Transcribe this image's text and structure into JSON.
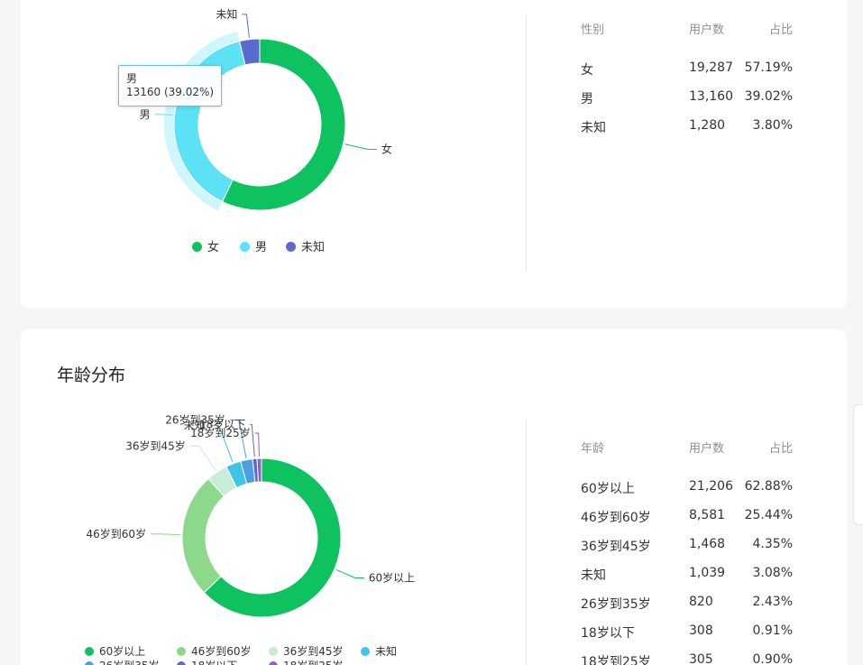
{
  "gender": {
    "table": {
      "headers": [
        "性别",
        "用户数",
        "占比"
      ],
      "rows": [
        [
          "女",
          "19,287",
          "57.19%"
        ],
        [
          "男",
          "13,160",
          "39.02%"
        ],
        [
          "未知",
          "1,280",
          "3.80%"
        ]
      ]
    },
    "tooltip": {
      "name": "男",
      "value": "13160 (39.02%)"
    }
  },
  "age": {
    "title": "年龄分布",
    "table": {
      "headers": [
        "年龄",
        "用户数",
        "占比"
      ],
      "rows": [
        [
          "60岁以上",
          "21,206",
          "62.88%"
        ],
        [
          "46岁到60岁",
          "8,581",
          "25.44%"
        ],
        [
          "36岁到45岁",
          "1,468",
          "4.35%"
        ],
        [
          "未知",
          "1,039",
          "3.08%"
        ],
        [
          "26岁到35岁",
          "820",
          "2.43%"
        ],
        [
          "18岁以下",
          "308",
          "0.91%"
        ],
        [
          "18岁到25岁",
          "305",
          "0.90%"
        ]
      ]
    }
  },
  "chart_data": [
    {
      "type": "pie",
      "variant": "donut",
      "categories": [
        "女",
        "男",
        "未知"
      ],
      "values": [
        19287,
        13160,
        1280
      ],
      "colors": [
        "#0dc25f",
        "#5ce1f5",
        "#5b6bcd"
      ],
      "highlighted": "男",
      "legend": "bottom"
    },
    {
      "type": "pie",
      "variant": "donut",
      "categories": [
        "60岁以上",
        "46岁到60岁",
        "36岁到45岁",
        "未知",
        "26岁到35岁",
        "18岁以下",
        "18岁到25岁"
      ],
      "values": [
        21206,
        8581,
        1468,
        1039,
        820,
        308,
        305
      ],
      "colors": [
        "#0dc25f",
        "#8ed88c",
        "#c9ecd6",
        "#3fc4e4",
        "#4a9fe0",
        "#5b6bcd",
        "#8e5fc9"
      ],
      "legend": "bottom"
    }
  ]
}
